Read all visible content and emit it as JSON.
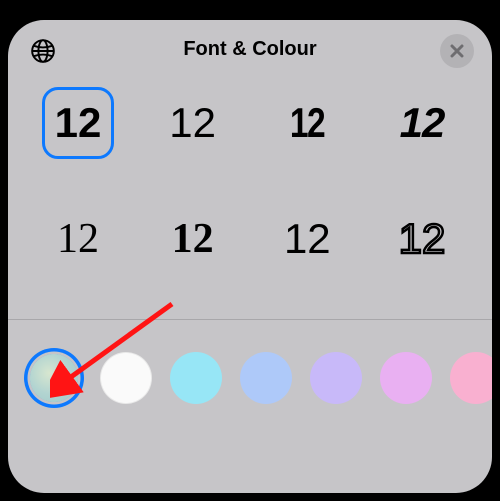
{
  "header": {
    "title": "Font & Colour"
  },
  "fonts": {
    "items": [
      {
        "sample": "12",
        "selected": true
      },
      {
        "sample": "12",
        "selected": false
      },
      {
        "sample": "12",
        "selected": false
      },
      {
        "sample": "12",
        "selected": false
      },
      {
        "sample": "12",
        "selected": false
      },
      {
        "sample": "12",
        "selected": false
      },
      {
        "sample": "12",
        "selected": false
      },
      {
        "sample": "12",
        "selected": false
      }
    ]
  },
  "colors": {
    "items": [
      {
        "name": "gradient-teal",
        "selected": true
      },
      {
        "name": "white",
        "selected": false
      },
      {
        "name": "cyan",
        "selected": false
      },
      {
        "name": "blue",
        "selected": false
      },
      {
        "name": "purple",
        "selected": false
      },
      {
        "name": "magenta",
        "selected": false
      },
      {
        "name": "pink",
        "selected": false
      }
    ]
  }
}
